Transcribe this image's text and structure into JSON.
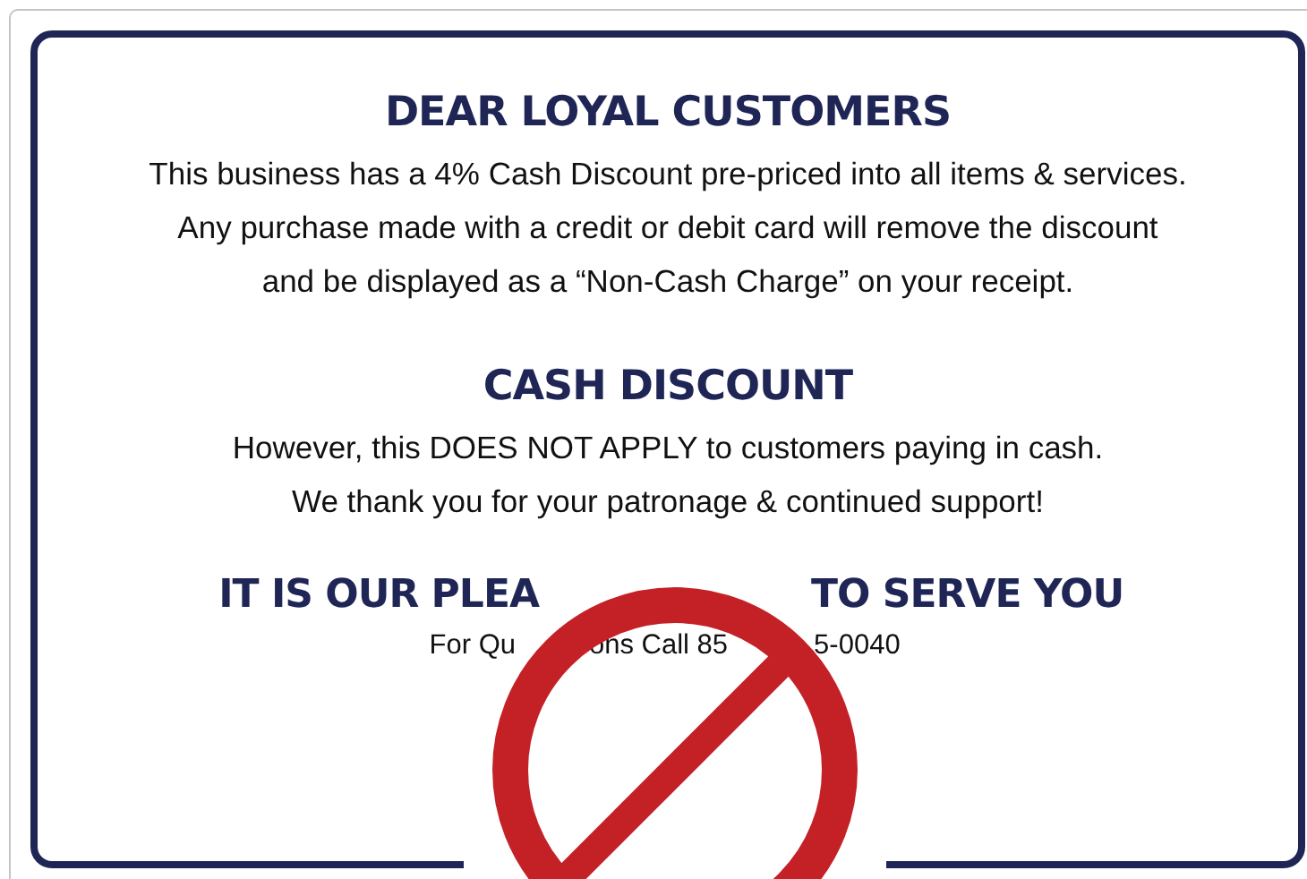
{
  "sections": [
    {
      "heading": "DEAR LOYAL CUSTOMERS",
      "lines": [
        "This business has a 4% Cash Discount pre-priced into all items & services.",
        "Any purchase made with a credit or debit card will remove the discount",
        "and be displayed as a “Non-Cash Charge” on your receipt."
      ]
    },
    {
      "heading": "CASH DISCOUNT",
      "lines": [
        "However, this DOES NOT APPLY to customers paying in cash.",
        "We thank you for your patronage & continued support!"
      ]
    }
  ],
  "closing": {
    "heading_parts": [
      "IT IS OUR PLEA",
      "TO SERVE YOU"
    ],
    "phone_parts": [
      "For Qu",
      "ons Call 85",
      "5-0040"
    ]
  }
}
